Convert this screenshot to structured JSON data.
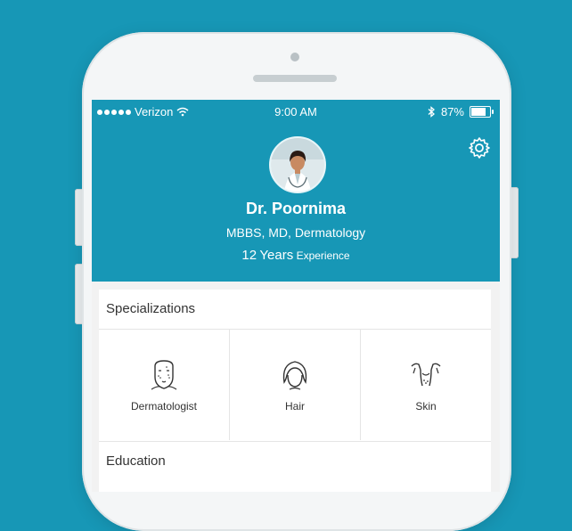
{
  "status_bar": {
    "carrier": "Verizon",
    "time": "9:00 AM",
    "battery": "87%",
    "battery_level": 0.87
  },
  "profile": {
    "name": "Dr. Poornima",
    "qualifications": "MBBS, MD, Dermatology",
    "experience_years": "12",
    "experience_unit": "Years",
    "experience_label": "Experience"
  },
  "specializations": {
    "title": "Specializations",
    "items": [
      {
        "label": "Dermatologist",
        "icon": "face-icon"
      },
      {
        "label": "Hair",
        "icon": "hair-icon"
      },
      {
        "label": "Skin",
        "icon": "body-icon"
      }
    ]
  },
  "education": {
    "title": "Education"
  },
  "colors": {
    "brand": "#1797b6",
    "card": "#ffffff",
    "text": "#333333"
  }
}
